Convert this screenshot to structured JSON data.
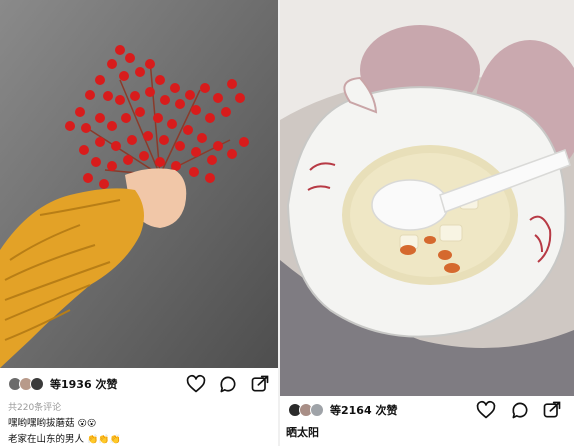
{
  "left_post": {
    "likes_text": "等1936 次赞",
    "comment_count_text": "共220条评论",
    "comments": [
      {
        "text": "嘿哟嘿哟拔蘑菇",
        "emoji": "😮😮"
      },
      {
        "text": "老家在山东的男人",
        "emoji": "👏👏👏"
      }
    ]
  },
  "right_post": {
    "likes_text": "等2164 次赞",
    "caption": "晒太阳"
  },
  "icons": [
    "heart-icon",
    "comment-icon",
    "share-icon",
    "avatar"
  ]
}
